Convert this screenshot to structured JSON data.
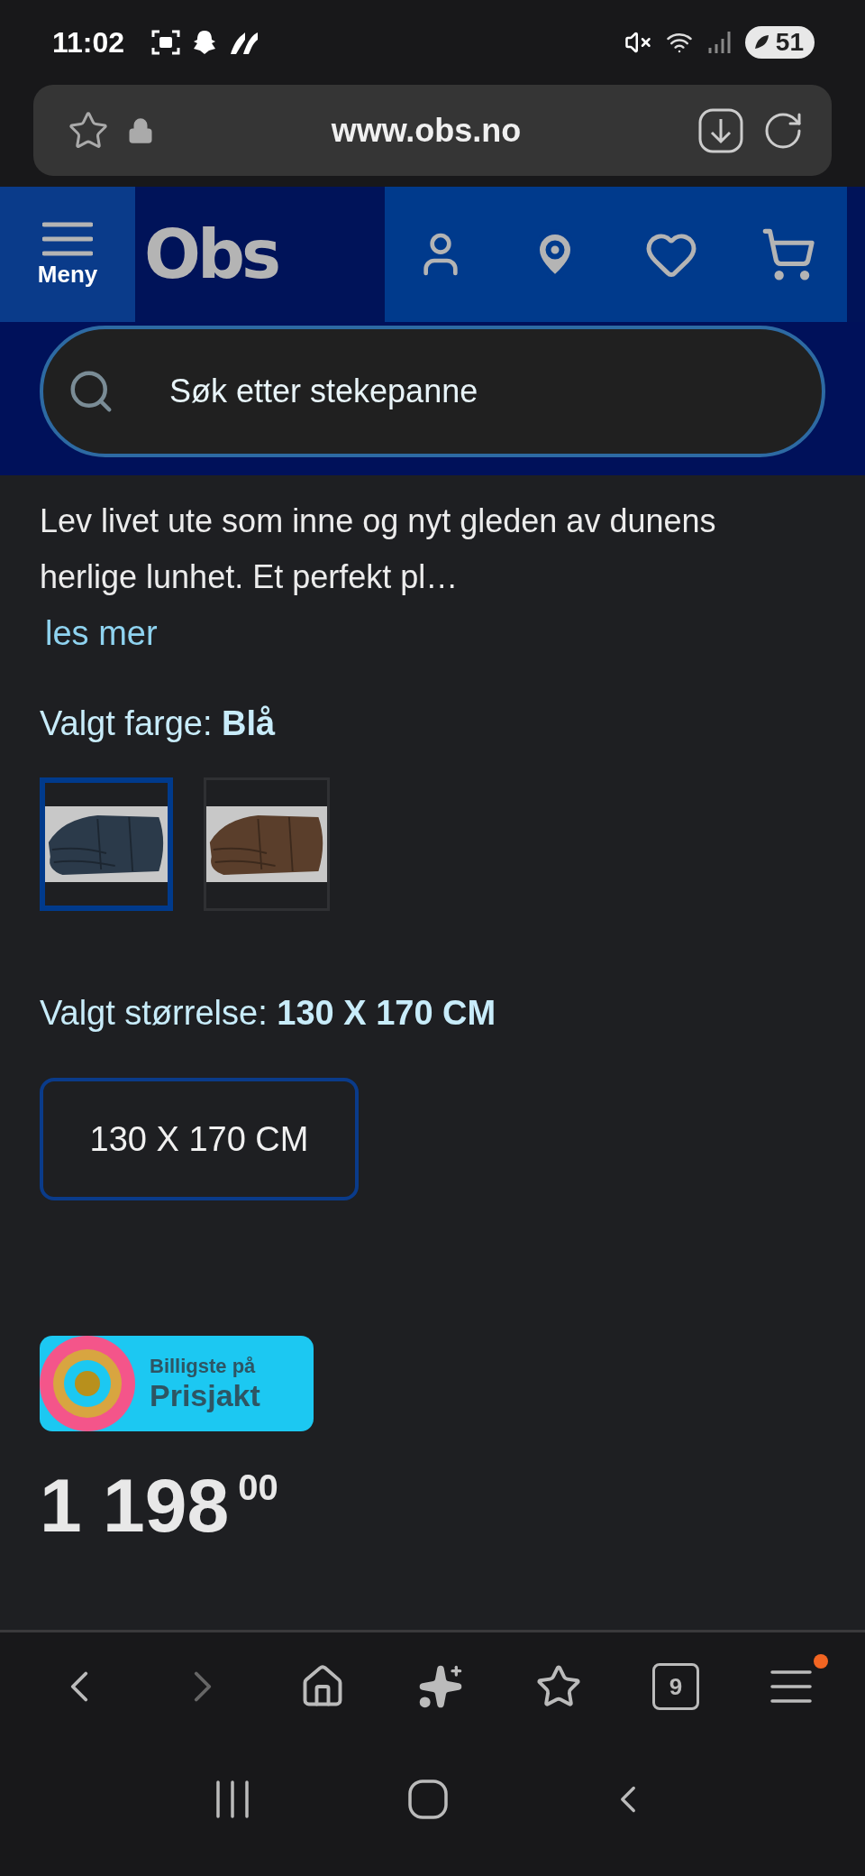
{
  "status_bar": {
    "time": "11:02",
    "battery": "51"
  },
  "browser_bar": {
    "url": "www.obs.no"
  },
  "header": {
    "menu_label": "Meny",
    "logo": "Obs"
  },
  "search": {
    "placeholder": "Søk etter stekepanne"
  },
  "product": {
    "description": "Lev livet ute som inne og nyt gleden av dunens herlige lunhet. Et perfekt pl…",
    "read_more": "les mer",
    "color_label": "Valgt farge:",
    "color_value": "Blå",
    "swatches": [
      {
        "color": "#2b3a4a",
        "selected": true
      },
      {
        "color": "#5a3e2b",
        "selected": false
      }
    ],
    "size_label": "Valgt størrelse:",
    "size_value": "130 X 170 CM",
    "sizes": [
      {
        "label": "130 X 170 CM",
        "selected": true
      }
    ],
    "badge": {
      "line_1": "Billigste på",
      "line_2": "Prisjakt"
    },
    "price": {
      "whole": "1 198",
      "decimals": "00"
    }
  },
  "bottom_bar": {
    "tab_count": "9",
    "menu_notification": true
  }
}
